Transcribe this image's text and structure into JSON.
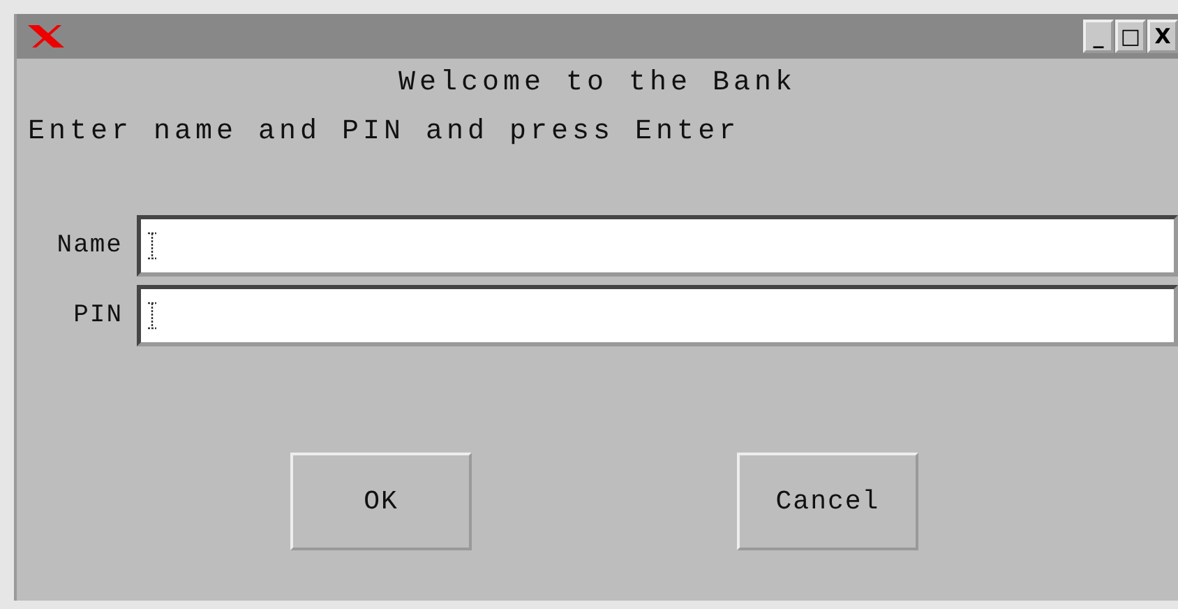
{
  "window": {
    "title": "Welcome to the Bank",
    "controls": [
      "_",
      "□",
      "X"
    ]
  },
  "instruction": "Enter name and PIN and press Enter",
  "fields": [
    {
      "label": "Name"
    },
    {
      "label": "PIN"
    }
  ],
  "buttons": [
    "OK",
    "Cancel"
  ]
}
